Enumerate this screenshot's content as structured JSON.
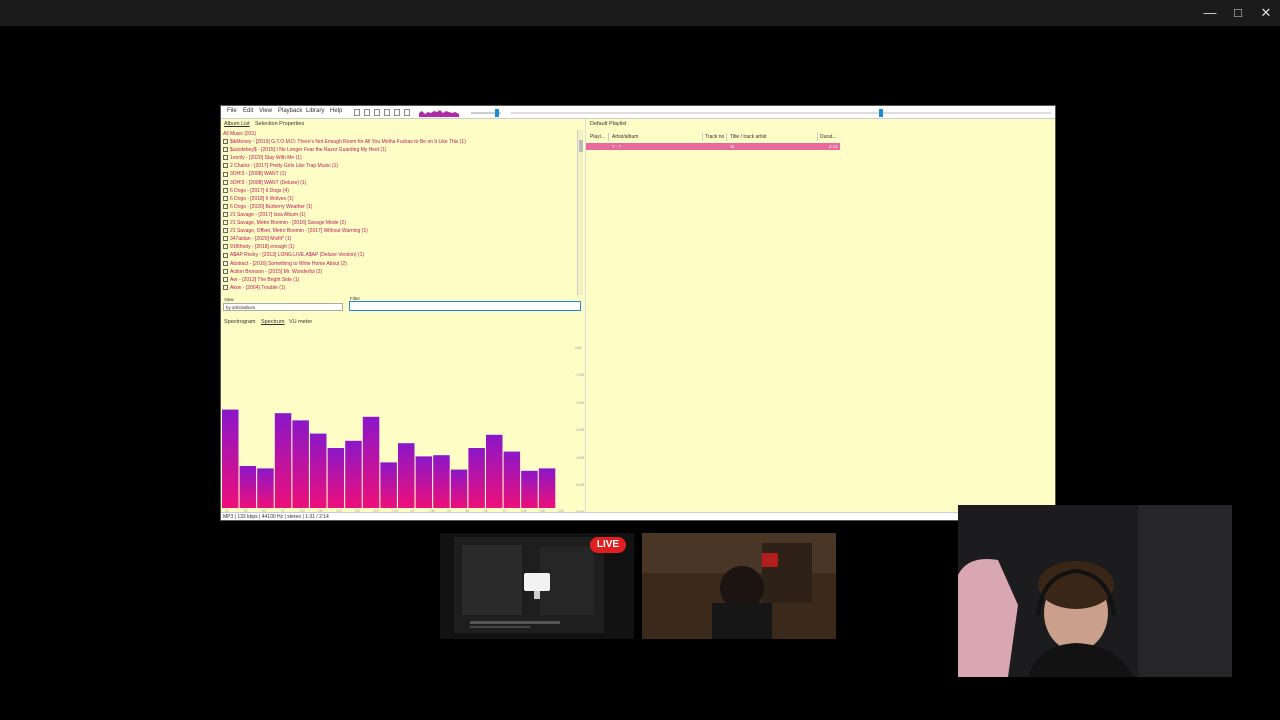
{
  "foobar": {
    "menu": [
      "File",
      "Edit",
      "View",
      "Playback",
      "Library",
      "Help"
    ],
    "left_tabs": [
      "Album List",
      "Selection Properties"
    ],
    "album_list": {
      "root": "All Music (931)",
      "rows": [
        "$ikMoney - [2019] G.T.O.M.D: There's Not Enough Room for All You Motha Fuckas to Be on It Like This (1)",
        "$uicideboy$ - [2015] I No Longer Fear the Razor Guarding My Heel (1)",
        "1nonly - [2020] Stay With Me (1)",
        "2 Chainz - [2017] Pretty Girls Like Trap Music (1)",
        "3OH!3 - [2008] WANT (1)",
        "3OH!3 - [2008] WANT (Deluxe) (1)",
        "6 Dogs - [2017] 6 Dogs (4)",
        "6 Dogs - [2018] 6 Wolves (1)",
        "6 Dogs - [2020] Burberry Weather (1)",
        "21 Savage - [2017] Issa Album (1)",
        "21 Savage, Metro Boomin - [2016] Savage Mode (2)",
        "21 Savage, Offset, Metro Boomin - [2017] Without Warning (1)",
        "347aidan - [2020] Misfit* (1)",
        "918thirdy - [2018] enough (1)",
        "A$AP Rocky - [2013] LONG.LIVE.A$AP (Deluxe Version) (1)",
        "Abstract - [2016] Something to Write Home About (2)",
        "Action Bronson - [2015] Mr. Wonderful (2)",
        "Aer - [2012] The Bright Side (1)",
        "Akon - [2004] Trouble (1)"
      ]
    },
    "view_label": "View",
    "view_value": "by artist/album",
    "filter_label": "Filter",
    "vis_tabs": [
      "Spectrogram",
      "Spectrum",
      "VU meter"
    ],
    "freq_labels": [
      "20",
      "30",
      "50",
      "70",
      "100",
      "150",
      "200",
      "300",
      "500",
      "700",
      "1k",
      "1.5k",
      "2k",
      "3k",
      "5k",
      "7k",
      "10k",
      "15k",
      "20k"
    ],
    "db_labels": [
      "0dB",
      "-10dB",
      "-20dB",
      "-30dB",
      "-40dB",
      "-50dB",
      "-60dB"
    ],
    "status": "MP3 | 133 kbps | 44100 Hz | stereo | 1:31 / 2:14",
    "playlist": {
      "tab": "Default Playlist",
      "columns": [
        "Playi...",
        "Artist/album",
        "Track no",
        "Title / track artist",
        "Durat..."
      ],
      "row": {
        "playing": "",
        "artist": "? - ?",
        "track": "11",
        "title": "",
        "duration": "2:14"
      }
    }
  },
  "spectrum": {
    "levels": [
      0.82,
      0.35,
      0.33,
      0.79,
      0.73,
      0.62,
      0.5,
      0.56,
      0.76,
      0.38,
      0.54,
      0.43,
      0.44,
      0.32,
      0.5,
      0.61,
      0.47,
      0.31,
      0.33
    ]
  },
  "stream": {
    "live": "LIVE"
  },
  "colors": {
    "accent": "#1e8bd6",
    "panel_bg": "#fdfdc5",
    "row_highlight": "#e8699b",
    "text_link": "#c0185e",
    "live_red": "#e02020"
  }
}
